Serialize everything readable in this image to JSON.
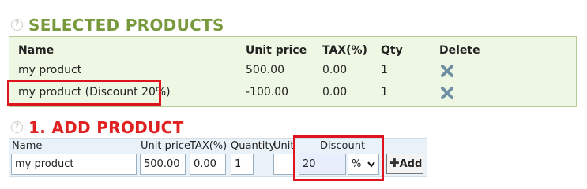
{
  "selected": {
    "title": "SELECTED PRODUCTS",
    "headers": {
      "name": "Name",
      "unit_price": "Unit price",
      "tax": "TAX(%)",
      "qty": "Qty",
      "delete": "Delete"
    },
    "rows": [
      {
        "name": "my product",
        "unit_price": "500.00",
        "tax": "0.00",
        "qty": "1"
      },
      {
        "name": "my product (Discount 20%)",
        "unit_price": "-100.00",
        "tax": "0.00",
        "qty": "1"
      }
    ]
  },
  "add": {
    "title": "1. ADD PRODUCT",
    "labels": {
      "name": "Name",
      "unit_price": "Unit price",
      "tax": "TAX(%)",
      "quantity": "Quantity",
      "unit": "Unit",
      "discount": "Discount"
    },
    "values": {
      "name": "my product",
      "unit_price": "500.00",
      "tax": "0.00",
      "quantity": "1",
      "unit": "",
      "discount": "20",
      "discount_type": "%"
    },
    "add_label": "Add"
  },
  "colors": {
    "selected_title": "#789a3d",
    "add_title": "#e02121",
    "highlight": "#e0141e",
    "delete_icon": "#6f8fa3"
  },
  "icons": {
    "help": "question-circle-icon",
    "delete": "x-mark-icon",
    "add": "plus-icon",
    "dropdown": "chevron-down-icon"
  }
}
